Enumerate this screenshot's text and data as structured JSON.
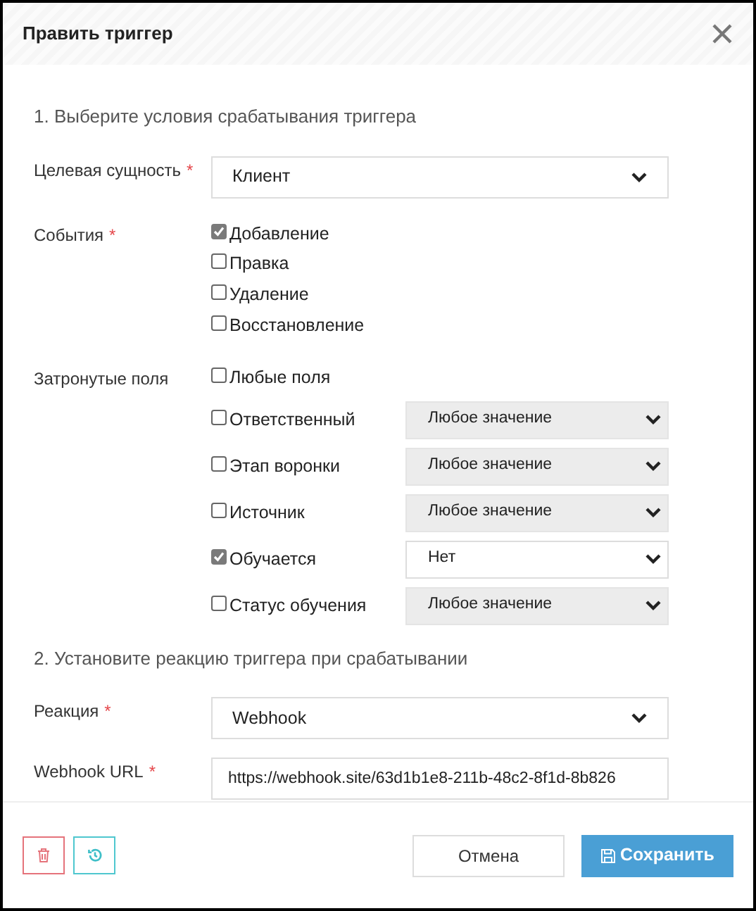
{
  "dialog": {
    "title": "Править триггер"
  },
  "section_1": {
    "heading": "1. Выберите условия срабатывания триггера"
  },
  "target_entity": {
    "label": "Целевая сущность",
    "required_mark": "*",
    "value": "Клиент"
  },
  "events": {
    "label": "События",
    "required_mark": "*",
    "options": [
      {
        "label": "Добавление",
        "checked": true
      },
      {
        "label": "Правка",
        "checked": false
      },
      {
        "label": "Удаление",
        "checked": false
      },
      {
        "label": "Восстановление",
        "checked": false
      }
    ]
  },
  "affected_fields": {
    "label": "Затронутые поля",
    "options": [
      {
        "kind": "plain",
        "label": "Любые поля",
        "checked": false
      },
      {
        "kind": "select",
        "label": "Ответственный",
        "checked": false,
        "value": "Любое значение"
      },
      {
        "kind": "select",
        "label": "Этап воронки",
        "checked": false,
        "value": "Любое значение"
      },
      {
        "kind": "select",
        "label": "Источник",
        "checked": false,
        "value": "Любое значение"
      },
      {
        "kind": "select",
        "label": "Обучается",
        "checked": true,
        "value": "Нет"
      },
      {
        "kind": "select",
        "label": "Статус обучения",
        "checked": false,
        "value": "Любое значение"
      }
    ]
  },
  "section_2": {
    "heading": "2. Установите реакцию триггера при срабатывании"
  },
  "reaction": {
    "label": "Реакция",
    "required_mark": "*",
    "value": "Webhook"
  },
  "webhook_url": {
    "label": "Webhook URL",
    "required_mark": "*",
    "value": "https://webhook.site/63d1b1e8-211b-48c2-8f1d-8b826"
  },
  "footer": {
    "cancel": "Отмена",
    "save": "Сохранить"
  }
}
